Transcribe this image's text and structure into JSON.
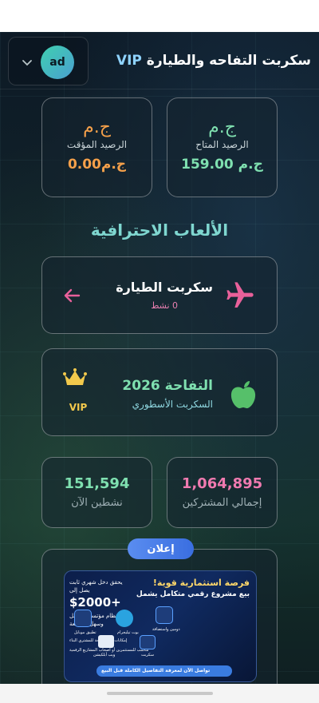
{
  "header": {
    "title": "سكربت التفاحه والطيارة",
    "title_tag": "VIP",
    "user_initials": "ad"
  },
  "balances": {
    "available": {
      "currency_symbol": "ج.م",
      "label": "الرصيد المتاح",
      "amount": "159.00 ج.م"
    },
    "temporary": {
      "currency_symbol": "ج.م",
      "label": "الرصيد المؤقت",
      "amount": "0.00ج.م"
    }
  },
  "section_title": "الألعاب الاحترافية",
  "games": {
    "plane": {
      "title": "سكربت الطيارة",
      "status": "0 نشط"
    },
    "apple": {
      "title": "التفاحة 2026",
      "subtitle": "السكربت الأسطوري",
      "badge": "VIP"
    }
  },
  "stats": {
    "subscribers": {
      "value": "1,064,895",
      "label": "إجمالي المشتركين"
    },
    "active": {
      "value": "151,594",
      "label": "نشطين الآن"
    }
  },
  "ad": {
    "badge": "إعلان",
    "banner_title": "فرصة استثمارية قوية!",
    "banner_subtitle": "بيع مشروع رقمي متكامل يشمل",
    "income_line": "يحقق دخل شهري ثابت",
    "income_prefix": "يصل إلى",
    "income_amount": "$2000+",
    "feature_1": "النظام مؤتمت بالكامل",
    "feature_2": "وسهل التوسعة",
    "feature_3": "إمكانات أرباح متاحة للمشتري البناء",
    "feature_4": "مناسب للمستثمرين أو أصحاب المشاريع الرقمية",
    "item_domain": "دومين واستضافة",
    "item_telegram": "بوت تيليجرام",
    "item_mobile": "تطبيق موبايل",
    "item_script": "سكربت",
    "item_web": "ويب أبلكيشن",
    "cta": "تواصل الآن لمعرفة التفاصيل الكاملة قبل البيع"
  },
  "colors": {
    "accent_green": "#7fe0b0",
    "accent_orange": "#f5a04a",
    "accent_pink": "#f07ab0",
    "accent_teal": "#7fd7d0",
    "vip_gold": "#f2c94c"
  }
}
